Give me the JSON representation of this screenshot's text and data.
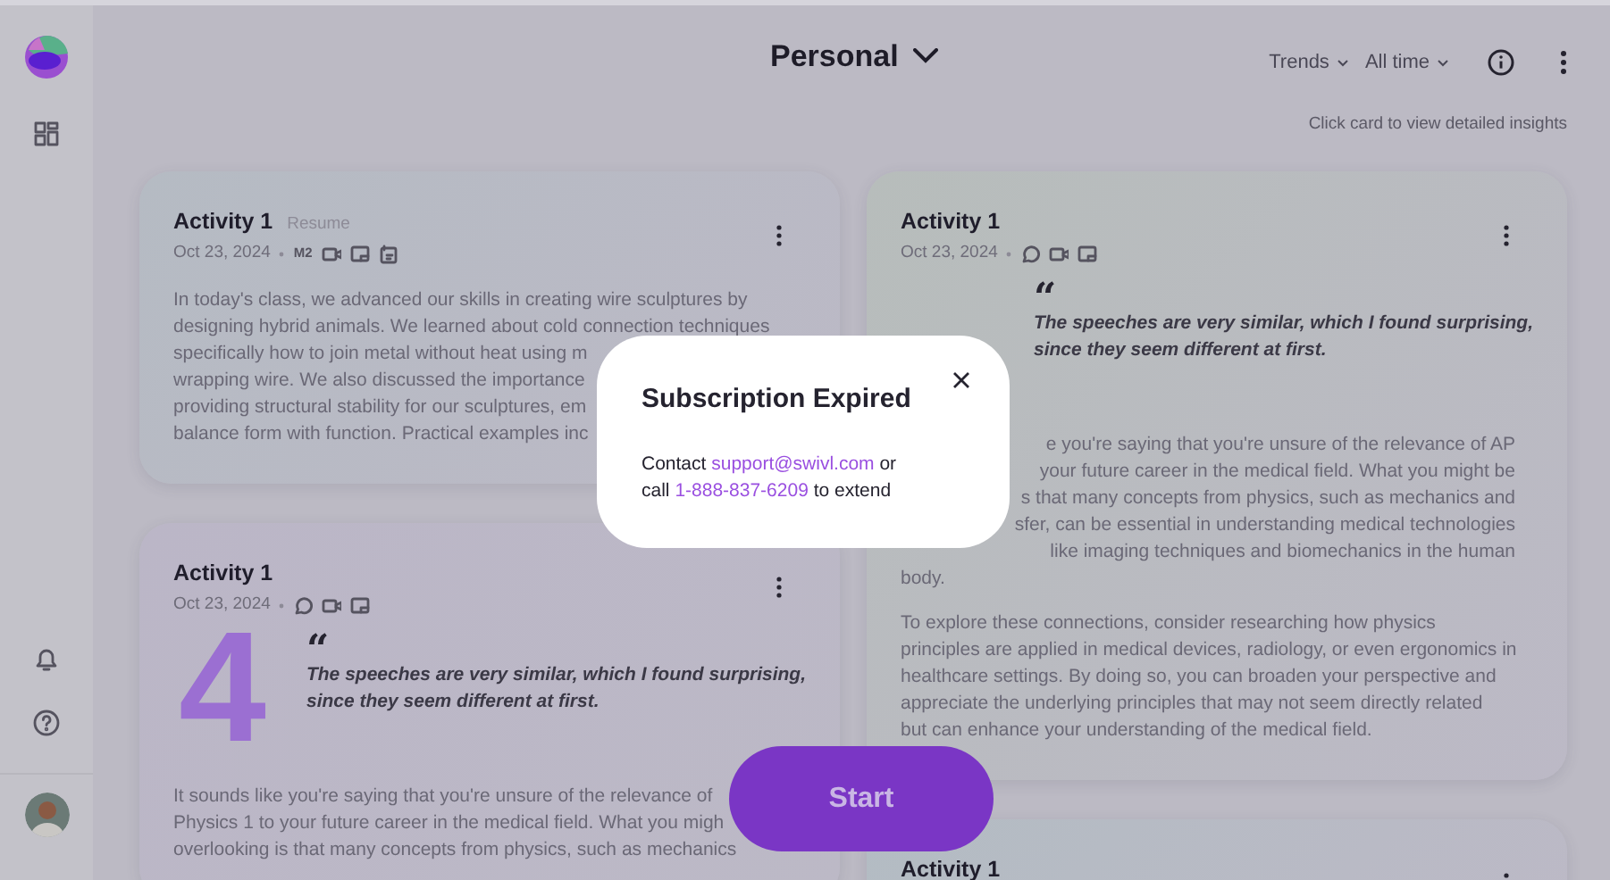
{
  "sidebar": {
    "top_items": [
      {
        "kind": "grid"
      }
    ],
    "bottom_items": [
      {
        "kind": "bell"
      },
      {
        "kind": "help"
      }
    ]
  },
  "header": {
    "title": "Personal",
    "filters": [
      {
        "label": "Trends"
      },
      {
        "label": "All time"
      }
    ],
    "hint": "Click card to view detailed insights"
  },
  "columns": [
    [
      {
        "color": "#b5bbc3",
        "title": "Activity 1",
        "tag": "Resume",
        "date": "Oct 23, 2024",
        "meta": [
          {
            "kind": "label",
            "text": "M2"
          },
          {
            "kind": "video"
          },
          {
            "kind": "screen"
          },
          {
            "kind": "notes"
          }
        ],
        "paragraphs": [
          [
            {
              "text": "In today's class, we advanced our skills in creating wire sculptures by"
            },
            {
              "text": "designing hybrid animals. We learned about cold connection techniques"
            },
            {
              "text": "specifically how to join metal without heat using m"
            },
            {
              "text": "wrapping wire. We also discussed the importance"
            },
            {
              "text": "providing structural stability for our sculptures, em"
            },
            {
              "text": "balance form with function. Practical examples inc"
            }
          ]
        ]
      },
      {
        "color": "#bbb6c7",
        "title": "Activity 1",
        "date": "Oct 23, 2024",
        "meta": [
          {
            "kind": "chat"
          },
          {
            "kind": "video"
          },
          {
            "kind": "screen"
          }
        ],
        "score": {
          "value": "4",
          "color": "#9b6fd2"
        },
        "quote": {
          "mark": "“",
          "lines": [
            "The speeches are very similar, which I found surprising,",
            "since they seem different at first."
          ]
        },
        "paragraphs": [
          [
            {
              "text": "It sounds like you're saying that you're unsure of the relevance of"
            },
            {
              "text": "Physics 1 to your future career in the medical field. What you migh"
            },
            {
              "text": "overlooking is that many concepts from physics, such as mechanics"
            }
          ]
        ]
      }
    ],
    [
      {
        "color": "#b7bdbb",
        "title": "Activity 1",
        "date": "Oct 23, 2024",
        "meta": [
          {
            "kind": "chat"
          },
          {
            "kind": "video"
          },
          {
            "kind": "screen"
          }
        ],
        "quote": {
          "mark": "“",
          "lines": [
            "The speeches are very similar, which I found surprising,",
            "since they seem different at first."
          ]
        },
        "paragraphs": [
          [
            {
              "text": "e you're saying that you're unsure of the relevance of AP",
              "cut_start": true
            },
            {
              "text": "your future career in the medical field. What you might be",
              "cut_start": true
            },
            {
              "text": "s that many concepts from physics, such as mechanics and",
              "cut_start": true
            },
            {
              "text": "sfer, can be essential in understanding medical technologies",
              "cut_start": true
            },
            {
              "text": "like imaging techniques and biomechanics in the human",
              "cut_start": true
            },
            {
              "text": "body."
            }
          ],
          [
            {
              "text": "To explore these connections, consider researching how physics"
            },
            {
              "text": "principles are applied in medical devices, radiology, or even ergonomics in"
            },
            {
              "text": "healthcare settings. By doing so, you can broaden your perspective and"
            },
            {
              "text": "appreciate the underlying principles that may not seem directly related"
            },
            {
              "text": "but can enhance your understanding of the medical field."
            }
          ]
        ]
      },
      {
        "color": "#b3bcc3",
        "title": "Activity 1"
      }
    ]
  ],
  "modal": {
    "title": "Subscription Expired",
    "body": [
      [
        {
          "text": "Contact "
        },
        {
          "link": "support@swivl.com"
        },
        {
          "text": " or"
        }
      ],
      [
        {
          "text": "call "
        },
        {
          "link": "1-888-837-6209"
        },
        {
          "text": " to extend"
        }
      ]
    ]
  },
  "start_button": {
    "label": "Start"
  }
}
